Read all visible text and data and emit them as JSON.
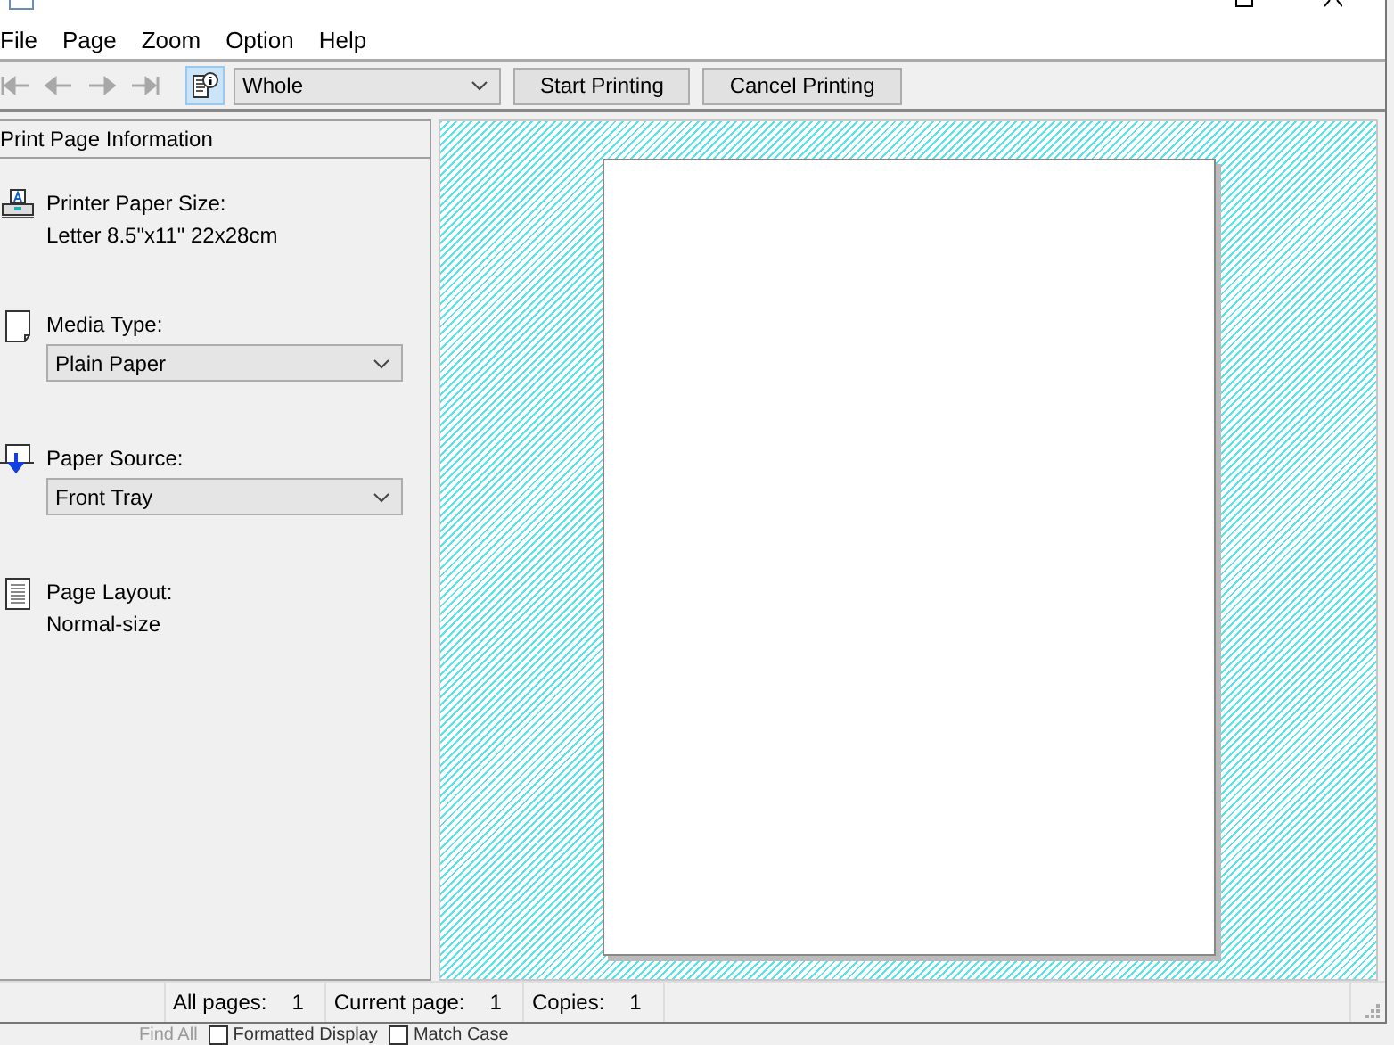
{
  "menu": [
    "File",
    "Page",
    "Zoom",
    "Option",
    "Help"
  ],
  "toolbar": {
    "nav_buttons": [
      {
        "kind": "first",
        "disabled": true
      },
      {
        "kind": "prev",
        "disabled": true
      },
      {
        "kind": "next",
        "disabled": true
      },
      {
        "kind": "last",
        "disabled": true
      }
    ],
    "info_toggle": {
      "selected": true
    },
    "zoom_select": {
      "value": "Whole"
    },
    "buttons": [
      "Start Printing",
      "Cancel Printing"
    ]
  },
  "panel": {
    "title": "Print Page Information",
    "items": [
      {
        "kind": "text",
        "label": "Printer Paper Size:",
        "value": "Letter 8.5\"x11\" 22x28cm"
      },
      {
        "kind": "select",
        "label": "Media Type:",
        "value": "Plain Paper"
      },
      {
        "kind": "select",
        "label": "Paper Source:",
        "value": "Front Tray"
      },
      {
        "kind": "text",
        "label": "Page Layout:",
        "value": "Normal-size"
      }
    ]
  },
  "status_bar": [
    {
      "label": "All pages:",
      "value": "1"
    },
    {
      "label": "Current page:",
      "value": "1"
    },
    {
      "label": "Copies:",
      "value": "1"
    }
  ],
  "background_strip": {
    "buttons": [
      "Find All"
    ],
    "checkboxes": [
      {
        "label": "Formatted Display",
        "checked": false
      },
      {
        "label": "Match Case",
        "checked": false
      }
    ]
  }
}
